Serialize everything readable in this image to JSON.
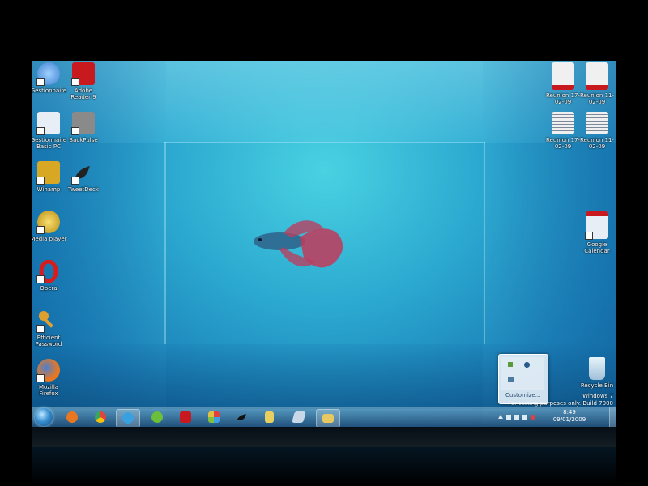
{
  "desktop": {
    "icons_left": [
      {
        "label": "Gestionnaire",
        "icon": "network-globe-icon",
        "color": "#3c7fd0"
      },
      {
        "label": "Adobe Reader 9",
        "icon": "pdf-icon",
        "color": "#c8191f"
      },
      {
        "label": "Gestionnaire Basic PC",
        "icon": "document-icon",
        "color": "#e8eef5"
      },
      {
        "label": "BackPulse",
        "icon": "monitor-icon",
        "color": "#8a8a8a"
      },
      {
        "label": "Winamp",
        "icon": "winamp-icon",
        "color": "#d8a824"
      },
      {
        "label": "TweetDeck",
        "icon": "bird-icon",
        "color": "#222222"
      },
      {
        "label": "Media player",
        "icon": "headphones-icon",
        "color": "#e8c020"
      },
      {
        "label": "Opera",
        "icon": "opera-icon",
        "color": "#d81c1c"
      },
      {
        "label": "Efficient Password",
        "icon": "key-icon",
        "color": "#e0a030"
      },
      {
        "label": "Mozilla Firefox",
        "icon": "firefox-icon",
        "color": "#e87722"
      }
    ],
    "icons_right": [
      {
        "label": "Reunion 17-02-09",
        "icon": "pdf-doc-icon",
        "color": "#f0f0f0"
      },
      {
        "label": "Reunion 11-02-09",
        "icon": "pdf-doc-icon",
        "color": "#f0f0f0"
      },
      {
        "label": "Reunion 17-02-09",
        "icon": "text-doc-icon",
        "color": "#f0f0f0"
      },
      {
        "label": "Reunion 11-02-09",
        "icon": "text-doc-icon",
        "color": "#f0f0f0"
      },
      {
        "label": "Google Calendar",
        "icon": "calendar-icon",
        "color": "#e8eef5"
      },
      {
        "label": "Recycle Bin",
        "icon": "recycle-bin-icon",
        "color": "#cfe3f0"
      }
    ],
    "watermark": {
      "line1": "Windows 7",
      "line2": "For testing purposes only. Build 7000"
    }
  },
  "taskbar": {
    "start_icon": "windows-orb-icon",
    "items": [
      {
        "name": "firefox",
        "icon": "firefox-icon",
        "color": "#e87722",
        "active": false
      },
      {
        "name": "chrome",
        "icon": "chrome-icon",
        "color": "#3ba55c",
        "active": false
      },
      {
        "name": "messenger",
        "icon": "messenger-icon",
        "color": "#3aa0e0",
        "active": true
      },
      {
        "name": "spotify",
        "icon": "spotify-icon",
        "color": "#6cbf3a",
        "active": false
      },
      {
        "name": "filezilla",
        "icon": "filezilla-icon",
        "color": "#c8191f",
        "active": false
      },
      {
        "name": "app-grid",
        "icon": "grid-icon",
        "color": "#7fc040",
        "active": false
      },
      {
        "name": "tweetdeck",
        "icon": "bird-icon",
        "color": "#222222",
        "active": false
      },
      {
        "name": "notes",
        "icon": "notepad-icon",
        "color": "#e8d060",
        "active": false
      },
      {
        "name": "eraser",
        "icon": "eraser-icon",
        "color": "#c8d8e8",
        "active": false
      },
      {
        "name": "explorer",
        "icon": "folder-icon",
        "color": "#e8c860",
        "active": true
      }
    ],
    "clock": {
      "time": "8:49",
      "date": "09/01/2009"
    }
  },
  "tray_popup": {
    "customize_label": "Customize..."
  }
}
